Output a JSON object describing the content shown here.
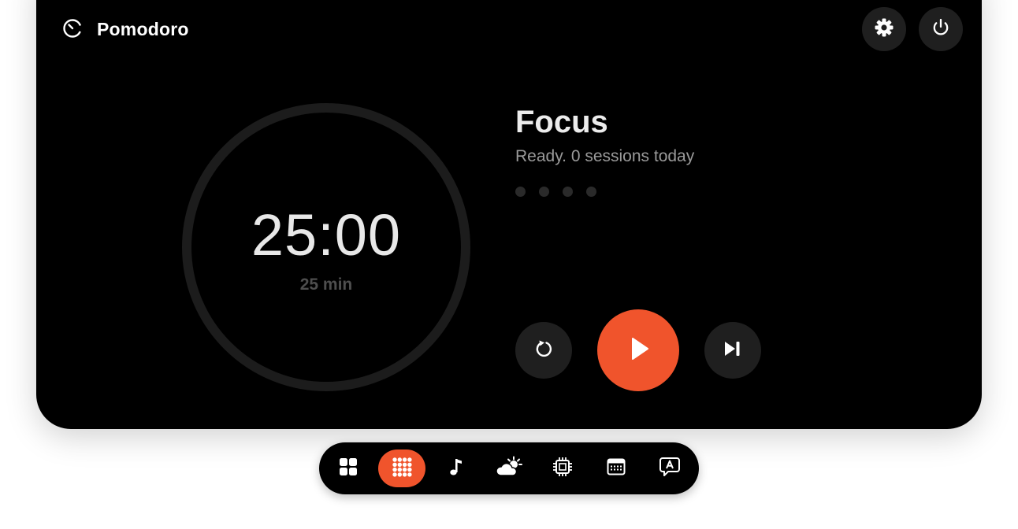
{
  "app": {
    "title": "Pomodoro"
  },
  "timer": {
    "time": "25:00",
    "duration_label": "25 min",
    "progress": 0
  },
  "session": {
    "mode": "Focus",
    "status": "Ready. 0 sessions today",
    "dots_total": 4,
    "dots_completed": 0
  },
  "header": {
    "buttons": [
      "gear-icon",
      "power-icon"
    ]
  },
  "controls": [
    "reset-icon",
    "play-icon",
    "skip-next-icon"
  ],
  "dock": {
    "items": [
      "widgets-grid-icon",
      "pomodoro-dots-icon",
      "music-note-icon",
      "weather-icon",
      "cpu-chip-icon",
      "calendar-icon",
      "translate-icon"
    ],
    "active_index": 1
  },
  "colors": {
    "accent": "#f0542c",
    "panel": "#000000",
    "button_bg": "#1f1f1f",
    "ring": "#1c1c1c"
  }
}
